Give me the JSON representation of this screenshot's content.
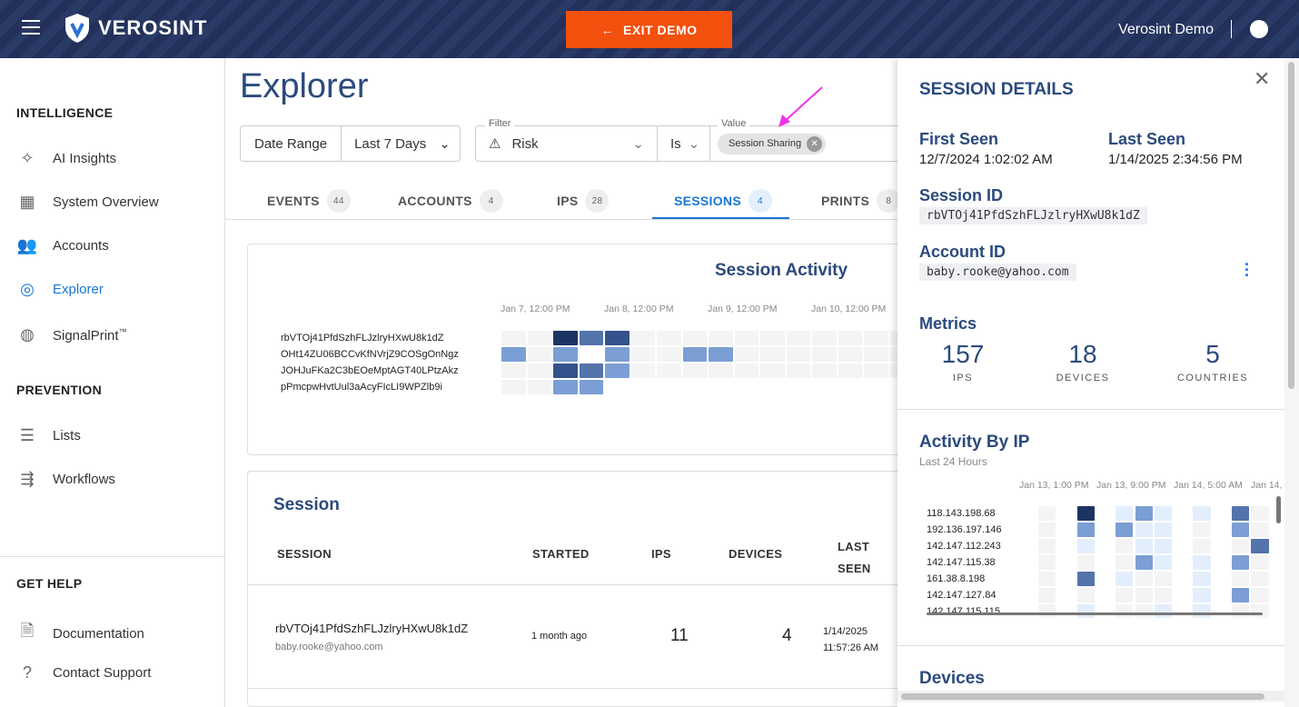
{
  "header": {
    "brand": "VEROSINT",
    "exit_label": "EXIT DEMO",
    "user": "Verosint Demo"
  },
  "sidebar": {
    "sections": [
      "INTELLIGENCE",
      "PREVENTION",
      "GET HELP"
    ],
    "items": [
      {
        "label": "AI Insights",
        "icon": "sparkle-icon"
      },
      {
        "label": "System Overview",
        "icon": "dashboard-icon"
      },
      {
        "label": "Accounts",
        "icon": "people-icon"
      },
      {
        "label": "Explorer",
        "icon": "compass-icon",
        "active": true
      },
      {
        "label": "SignalPrint",
        "sup": "™",
        "icon": "fingerprint-icon"
      },
      {
        "label": "Lists",
        "icon": "list-icon"
      },
      {
        "label": "Workflows",
        "icon": "workflow-icon"
      },
      {
        "label": "Documentation",
        "icon": "document-icon"
      },
      {
        "label": "Contact Support",
        "icon": "help-icon"
      }
    ]
  },
  "main": {
    "title": "Explorer",
    "date_range": {
      "label": "Date Range",
      "value": "Last 7 Days"
    },
    "filter": {
      "legend": "Filter",
      "field": "Risk",
      "operator": "Is",
      "value_legend": "Value",
      "chip": "Session Sharing"
    },
    "tabs": [
      {
        "label": "EVENTS",
        "count": "44"
      },
      {
        "label": "ACCOUNTS",
        "count": "4"
      },
      {
        "label": "IPS",
        "count": "28"
      },
      {
        "label": "SESSIONS",
        "count": "4",
        "active": true
      },
      {
        "label": "PRINTS",
        "count": "8"
      }
    ],
    "activity": {
      "title": "Session Activity",
      "ticks": [
        "Jan 7, 12:00 PM",
        "Jan 8, 12:00 PM",
        "Jan 9, 12:00 PM",
        "Jan 10, 12:00 PM"
      ],
      "rows": [
        "rbVTOj41PfdSzhFLJzlryHXwU8k1dZ",
        "OHt14ZU06BCCvKfNVrjZ9COSgOnNgz",
        "JOHJuFKa2C3bEOeMptAGT40LPtzAkz",
        "pPmcpwHvtUul3aAcyFIcLI9WPZlb9i"
      ],
      "levels": [
        [
          0,
          0,
          5,
          3,
          4,
          0,
          0,
          0,
          0,
          0,
          0,
          0,
          0,
          0,
          0,
          0
        ],
        [
          2,
          0,
          2,
          -1,
          2,
          0,
          0,
          2,
          2,
          0,
          0,
          0,
          0,
          0,
          0,
          0
        ],
        [
          0,
          0,
          4,
          3,
          2,
          0,
          0,
          0,
          0,
          0,
          0,
          0,
          0,
          0,
          0,
          0
        ],
        [
          0,
          0,
          2,
          2,
          -1,
          -1,
          -1,
          -1,
          -1,
          -1,
          -1,
          -1,
          -1,
          -1,
          -1,
          -1
        ]
      ]
    },
    "table": {
      "title": "Session",
      "headers": [
        "SESSION",
        "STARTED",
        "IPS",
        "DEVICES",
        "LAST SEEN"
      ],
      "rows": [
        {
          "session": "rbVTOj41PfdSzhFLJzlryHXwU8k1dZ",
          "account": "baby.rooke@yahoo.com",
          "started": "1 month ago",
          "ips": "11",
          "devices": "4",
          "last_seen_date": "1/14/2025",
          "last_seen_time": "11:57:26 AM"
        }
      ]
    }
  },
  "panel": {
    "title": "SESSION DETAILS",
    "first_seen_label": "First Seen",
    "first_seen": "12/7/2024 1:02:02 AM",
    "last_seen_label": "Last Seen",
    "last_seen": "1/14/2025 2:34:56 PM",
    "session_id_label": "Session ID",
    "session_id": "rbVTOj41PfdSzhFLJzlryHXwU8k1dZ",
    "account_id_label": "Account ID",
    "account_id": "baby.rooke@yahoo.com",
    "metrics_label": "Metrics",
    "metrics": [
      {
        "value": "157",
        "label": "IPS"
      },
      {
        "value": "18",
        "label": "DEVICES"
      },
      {
        "value": "5",
        "label": "COUNTRIES"
      }
    ],
    "activity_by_ip": {
      "title": "Activity By IP",
      "subtitle": "Last 24 Hours",
      "ticks": [
        "Jan 13, 1:00 PM",
        "Jan 13, 9:00 PM",
        "Jan 14, 5:00 AM",
        "Jan 14,"
      ],
      "rows": [
        "118.143.198.68",
        "192.136.197.146",
        "142.147.112.243",
        "142.147.115.38",
        "161.38.8.198",
        "142.147.127.84",
        "142.147.115.115"
      ],
      "levels": [
        [
          0,
          -1,
          5,
          -1,
          1,
          2,
          1,
          -1,
          1,
          -1,
          3,
          0
        ],
        [
          0,
          -1,
          2,
          -1,
          2,
          1,
          1,
          -1,
          0,
          -1,
          2,
          0
        ],
        [
          0,
          -1,
          1,
          -1,
          0,
          1,
          1,
          -1,
          0,
          -1,
          0,
          3
        ],
        [
          0,
          -1,
          0,
          -1,
          0,
          2,
          1,
          -1,
          1,
          -1,
          2,
          0
        ],
        [
          0,
          -1,
          3,
          -1,
          1,
          0,
          0,
          -1,
          1,
          -1,
          0,
          0
        ],
        [
          0,
          -1,
          0,
          -1,
          0,
          0,
          0,
          -1,
          1,
          -1,
          2,
          0
        ],
        [
          0,
          -1,
          1,
          -1,
          0,
          0,
          1,
          -1,
          1,
          -1,
          0,
          0
        ]
      ]
    },
    "devices_label": "Devices"
  },
  "colors": {
    "levels": [
      "#f4f4f4",
      "#e3eefc",
      "#7b9fd4",
      "#5374ab",
      "#34528c",
      "#1c3461"
    ],
    "accent": "#1976d2",
    "exit": "#f4500e",
    "heading": "#2b4a7d"
  }
}
